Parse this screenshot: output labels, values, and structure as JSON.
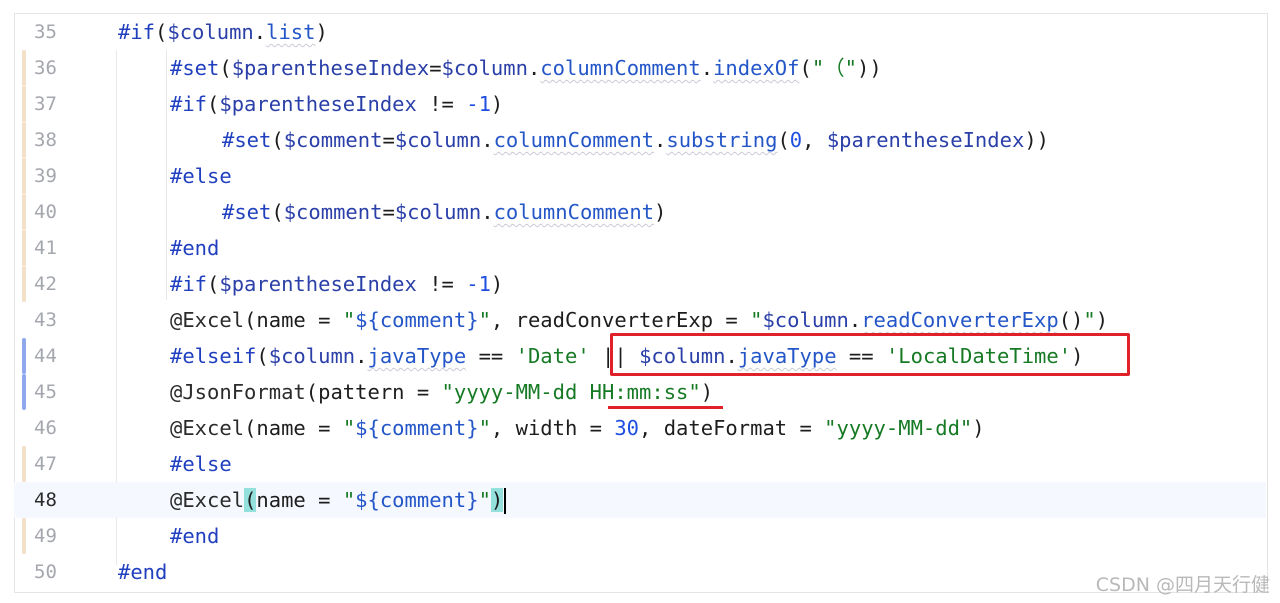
{
  "editor": {
    "current_line": 48,
    "lines": [
      {
        "num": "35",
        "indent": 0,
        "marker": "none"
      },
      {
        "num": "36",
        "indent": 1,
        "marker": "tan"
      },
      {
        "num": "37",
        "indent": 1,
        "marker": "tan"
      },
      {
        "num": "38",
        "indent": 2,
        "marker": "tan"
      },
      {
        "num": "39",
        "indent": 1,
        "marker": "tan"
      },
      {
        "num": "40",
        "indent": 2,
        "marker": "tan"
      },
      {
        "num": "41",
        "indent": 1,
        "marker": "tan"
      },
      {
        "num": "42",
        "indent": 1,
        "marker": "tan"
      },
      {
        "num": "43",
        "indent": 1,
        "marker": "none"
      },
      {
        "num": "44",
        "indent": 1,
        "marker": "blue"
      },
      {
        "num": "45",
        "indent": 1,
        "marker": "blue"
      },
      {
        "num": "46",
        "indent": 1,
        "marker": "none"
      },
      {
        "num": "47",
        "indent": 1,
        "marker": "tan"
      },
      {
        "num": "48",
        "indent": 1,
        "marker": "none"
      },
      {
        "num": "49",
        "indent": 1,
        "marker": "tan"
      },
      {
        "num": "50",
        "indent": 0,
        "marker": "none"
      }
    ],
    "code": {
      "l35": "#if($column.list)",
      "l36": "#set($parentheseIndex=$column.columnComment.indexOf(\"（\"))",
      "l37": "#if($parentheseIndex != -1)",
      "l38": "#set($comment=$column.columnComment.substring(0, $parentheseIndex))",
      "l39": "#else",
      "l40": "#set($comment=$column.columnComment)",
      "l41": "#end",
      "l42": "#if($parentheseIndex != -1)",
      "l43": "@Excel(name = \"${comment}\", readConverterExp = \"$column.readConverterExp()\")",
      "l44": "#elseif($column.javaType == 'Date' || $column.javaType == 'LocalDateTime')",
      "l45": "@JsonFormat(pattern = \"yyyy-MM-dd HH:mm:ss\")",
      "l46": "@Excel(name = \"${comment}\", width = 30, dateFormat = \"yyyy-MM-dd\")",
      "l47": "#else",
      "l48": "@Excel(name = \"${comment}\")",
      "l49": "#end",
      "l50": "#end"
    }
  },
  "annotations": {
    "highlight_box_text": "|| $column.javaType == 'LocalDateTime'",
    "underline_text": "HH:mm:ss",
    "color": "#e1212a"
  },
  "watermark": "CSDN @四月天行健",
  "colors": {
    "keyword": "#1f3fbf",
    "string": "#167a25",
    "number": "#1e4fe0",
    "current_line_bg": "#f5f8fe",
    "bracket_match": "#93e0dd"
  }
}
